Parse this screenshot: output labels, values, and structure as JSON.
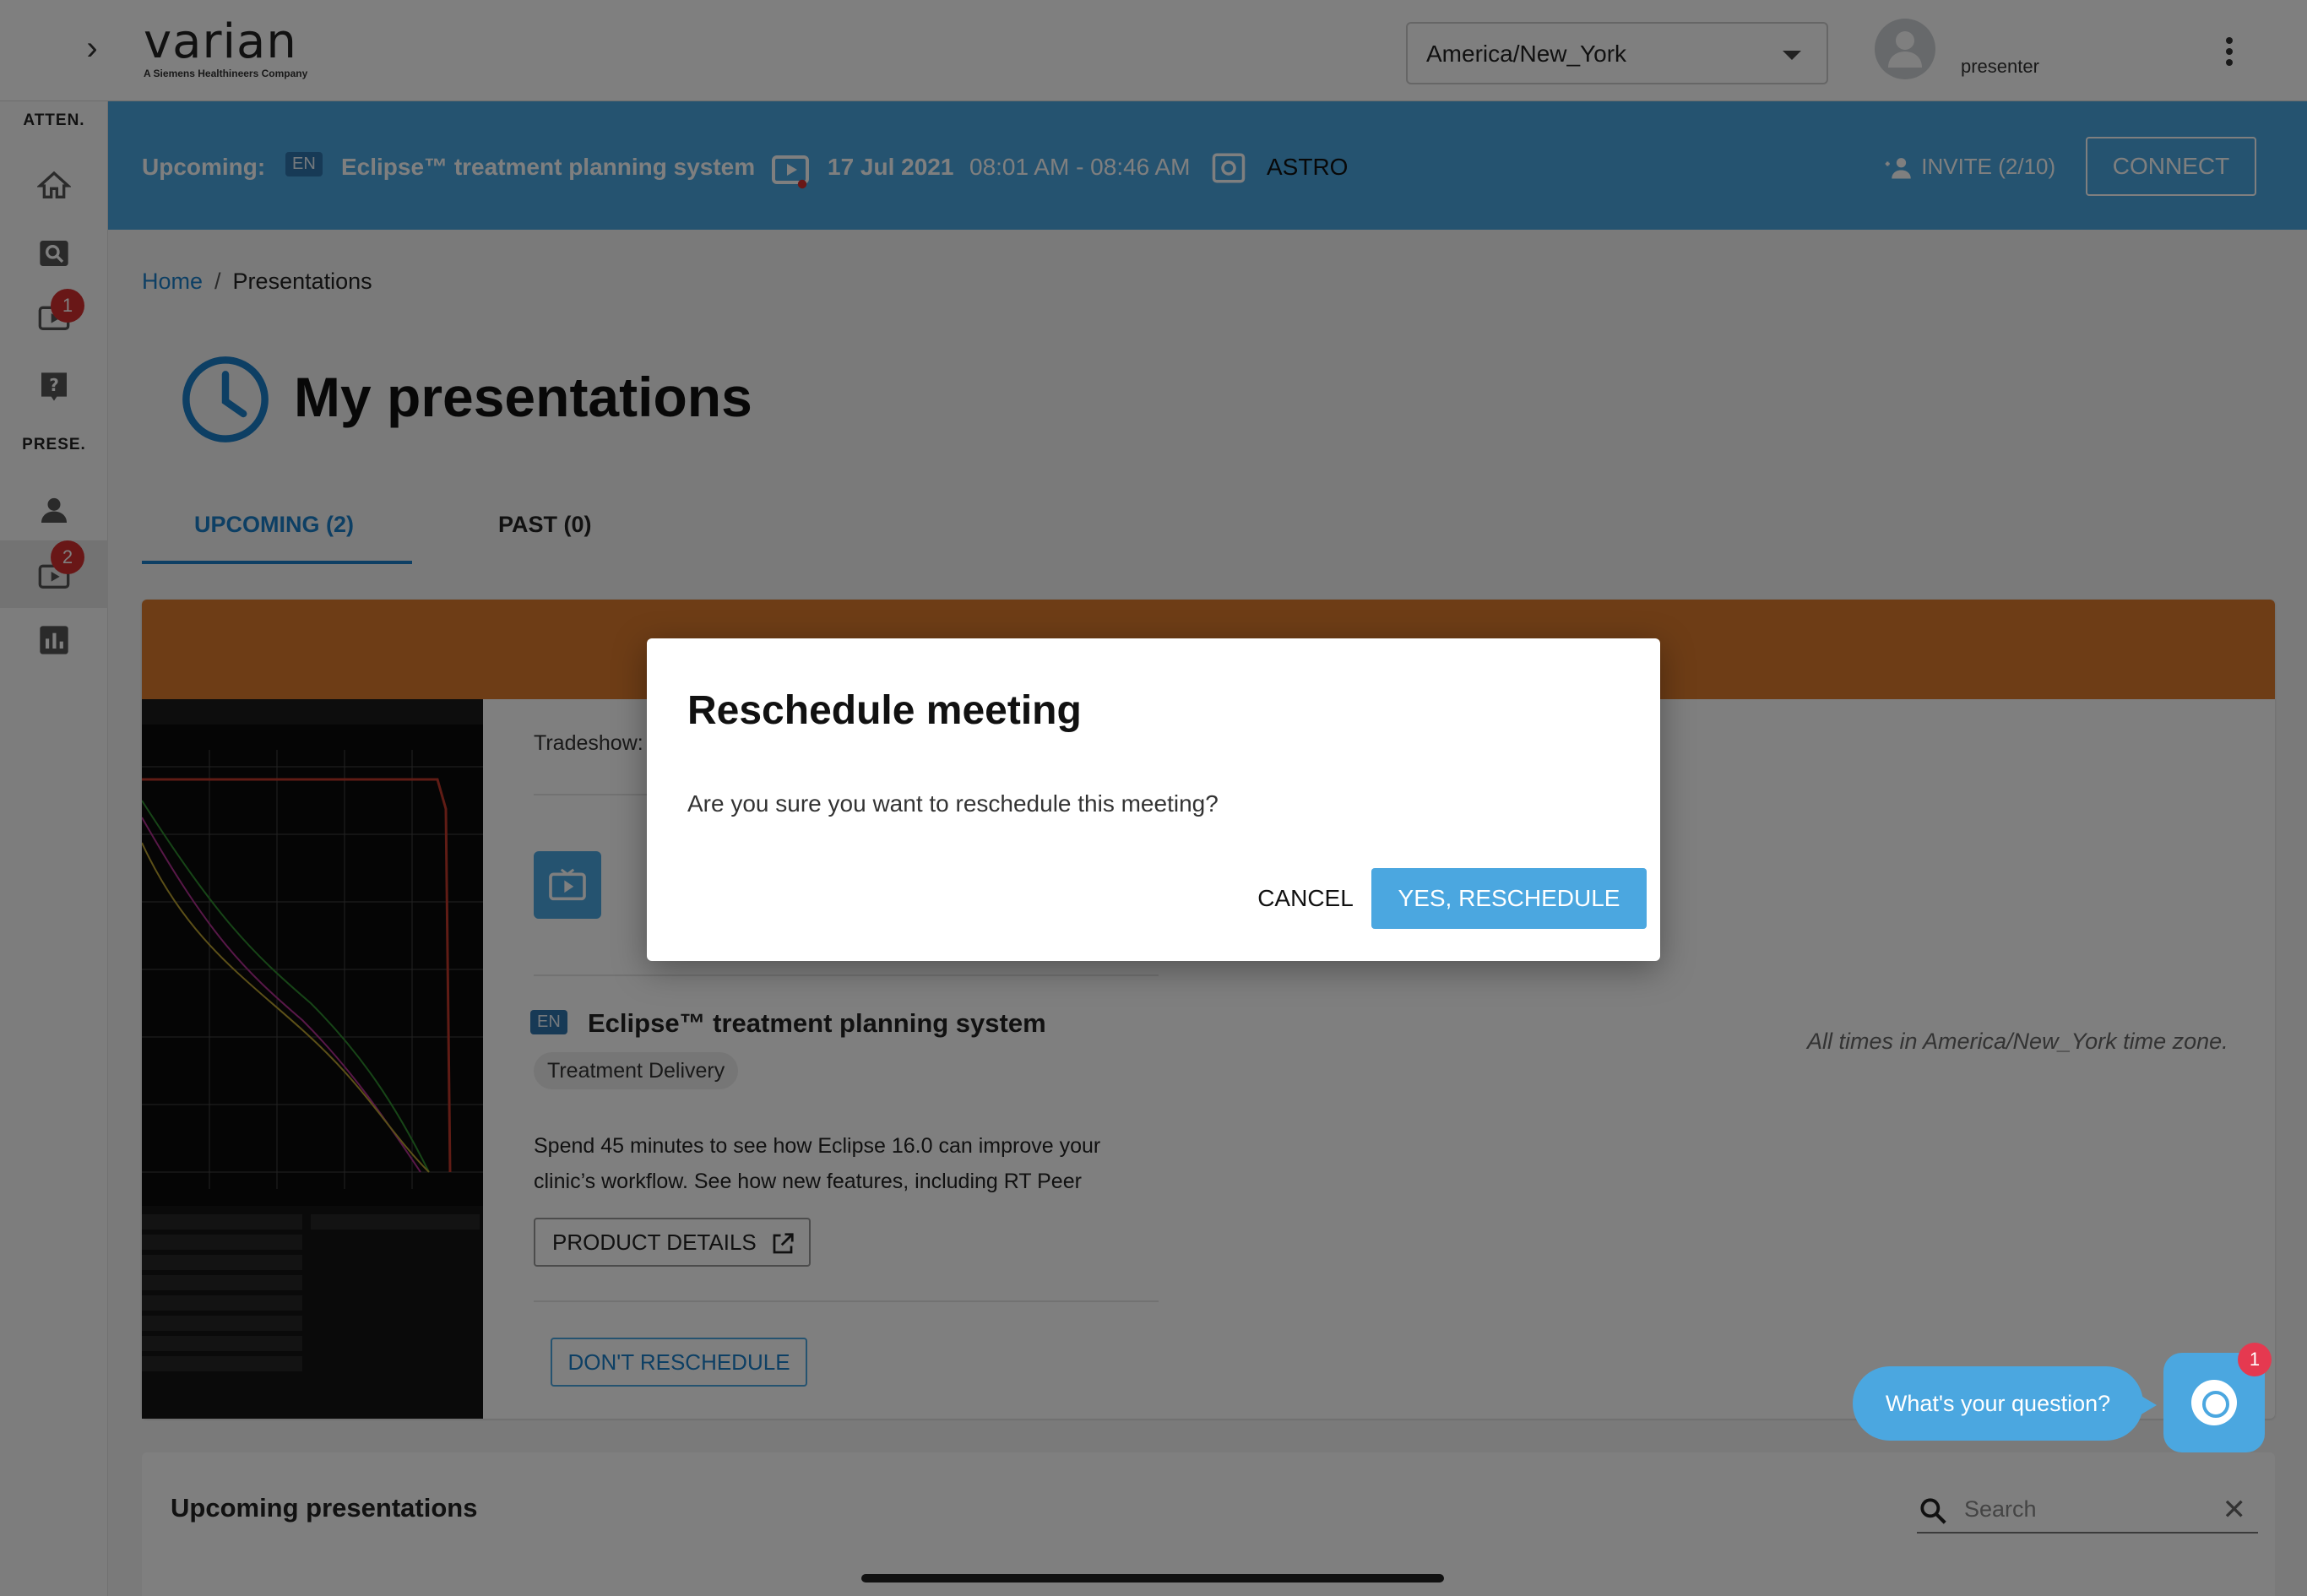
{
  "header": {
    "logo_text": "varian",
    "logo_tagline": "A Siemens Healthineers Company",
    "timezone_value": "America/New_York",
    "user_name": "presenter"
  },
  "sidebar": {
    "section_attendee": "ATTEN.",
    "section_presenter": "PRESE.",
    "badge_sessions": "1",
    "badge_presentations": "2"
  },
  "banner": {
    "upcoming_label": "Upcoming:",
    "lang": "EN",
    "title": "Eclipse™ treatment planning system",
    "date": "17 Jul 2021",
    "time": "08:01 AM - 08:46 AM",
    "event": "ASTRO",
    "invite_label": "INVITE (2/10)",
    "connect_label": "CONNECT"
  },
  "breadcrumb": {
    "home": "Home",
    "sep": "/",
    "current": "Presentations"
  },
  "page_title": "My presentations",
  "tabs": [
    {
      "label": "UPCOMING (2)"
    },
    {
      "label": "PAST (0)"
    }
  ],
  "card": {
    "tradeshow_label": "Tradeshow:",
    "lang": "EN",
    "title": "Eclipse™ treatment planning system",
    "category": "Treatment Delivery",
    "description": "Spend 45 minutes to see how Eclipse 16.0 can improve your clinic’s workflow. See how new features, including RT Peer",
    "details_button": "PRODUCT DETAILS",
    "dont_reschedule_button": "DON'T RESCHEDULE",
    "timezone_note": "All times in America/New_York time zone."
  },
  "upcoming_panel": {
    "title": "Upcoming presentations",
    "search_placeholder": "Search"
  },
  "dialog": {
    "title": "Reschedule meeting",
    "message": "Are you sure you want to reschedule this meeting?",
    "cancel_label": "CANCEL",
    "confirm_label": "YES, RESCHEDULE"
  },
  "chat": {
    "prompt": "What's your question?",
    "badge": "1"
  },
  "colors": {
    "primary": "#4ba7e0",
    "card_header": "#dd7a2d",
    "badge": "#d32f2f"
  }
}
